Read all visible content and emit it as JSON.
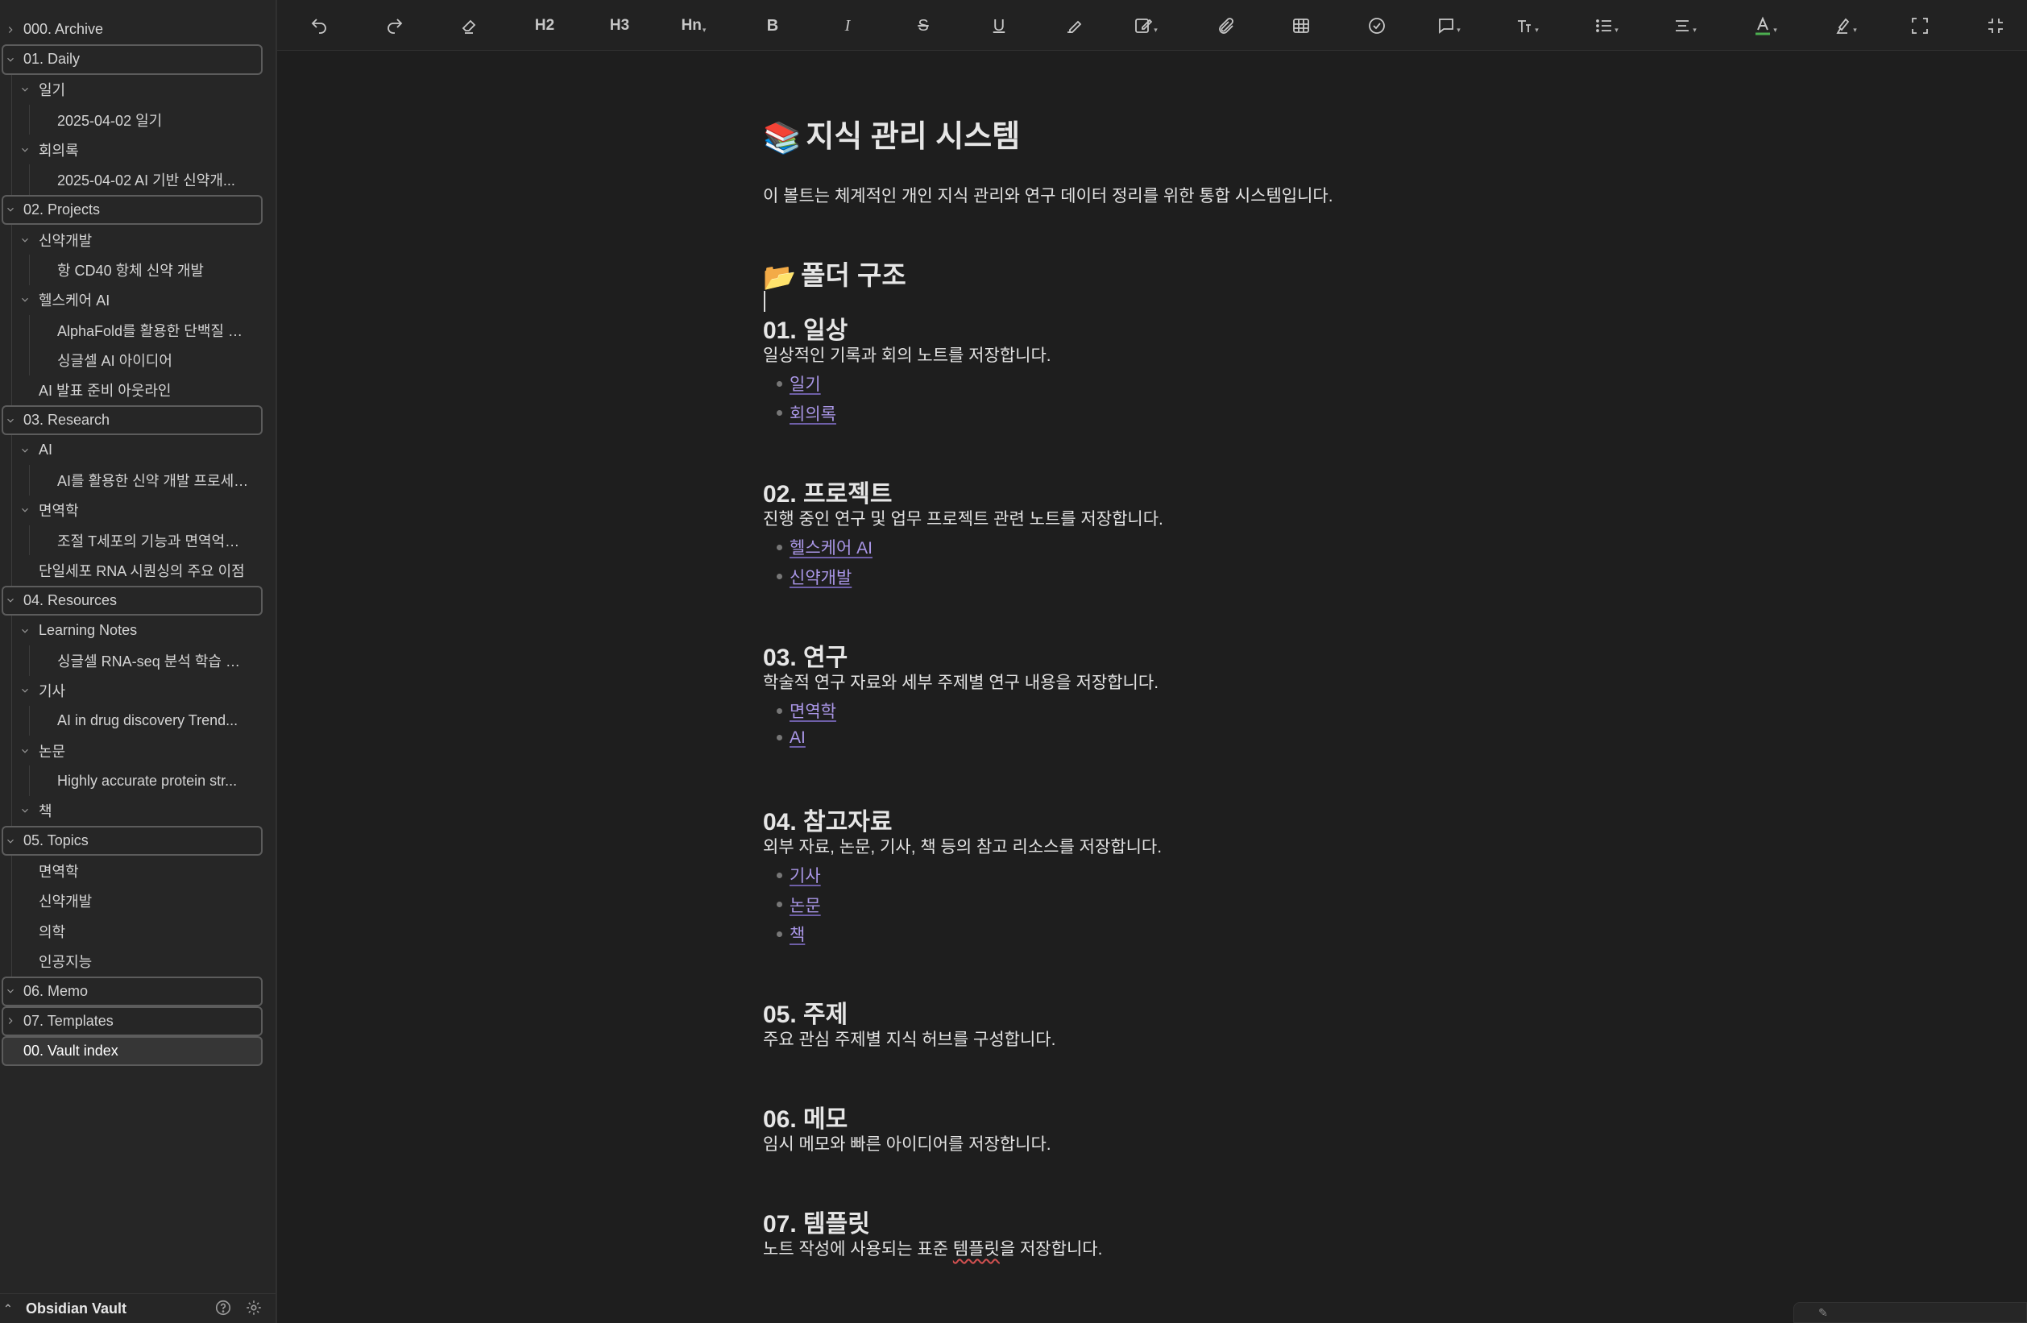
{
  "sidebar": {
    "tree": [
      {
        "label": "000. Archive",
        "depth": 0,
        "state": "collapsed",
        "style": "plain"
      },
      {
        "label": "01. Daily",
        "depth": 0,
        "state": "expanded",
        "style": "boxed"
      },
      {
        "label": "일기",
        "depth": 1,
        "state": "expanded"
      },
      {
        "label": "2025-04-02 일기",
        "depth": 2,
        "state": "leaf"
      },
      {
        "label": "회의록",
        "depth": 1,
        "state": "expanded"
      },
      {
        "label": "2025-04-02 AI 기반 신약개...",
        "depth": 2,
        "state": "leaf"
      },
      {
        "label": "02. Projects",
        "depth": 0,
        "state": "expanded",
        "style": "boxed"
      },
      {
        "label": "신약개발",
        "depth": 1,
        "state": "expanded"
      },
      {
        "label": "항 CD40 항체 신약 개발",
        "depth": 2,
        "state": "leaf"
      },
      {
        "label": "헬스케어 AI",
        "depth": 1,
        "state": "expanded"
      },
      {
        "label": "AlphaFold를 활용한 단백질 구...",
        "depth": 2,
        "state": "leaf"
      },
      {
        "label": "싱글셀 AI 아이디어",
        "depth": 2,
        "state": "leaf"
      },
      {
        "label": "AI 발표 준비 아웃라인",
        "depth": 1,
        "state": "leaf"
      },
      {
        "label": "03. Research",
        "depth": 0,
        "state": "expanded",
        "style": "boxed"
      },
      {
        "label": "AI",
        "depth": 1,
        "state": "expanded"
      },
      {
        "label": "AI를 활용한 신약 개발 프로세스...",
        "depth": 2,
        "state": "leaf"
      },
      {
        "label": "면역학",
        "depth": 1,
        "state": "expanded"
      },
      {
        "label": "조절 T세포의 기능과 면역억제 ...",
        "depth": 2,
        "state": "leaf"
      },
      {
        "label": "단일세포 RNA 시퀀싱의 주요 이점",
        "depth": 1,
        "state": "leaf"
      },
      {
        "label": "04. Resources",
        "depth": 0,
        "state": "expanded",
        "style": "boxed"
      },
      {
        "label": "Learning Notes",
        "depth": 1,
        "state": "expanded"
      },
      {
        "label": "싱글셀 RNA-seq 분석 학습 계획",
        "depth": 2,
        "state": "leaf"
      },
      {
        "label": "기사",
        "depth": 1,
        "state": "expanded"
      },
      {
        "label": "AI in drug discovery Trend...",
        "depth": 2,
        "state": "leaf"
      },
      {
        "label": "논문",
        "depth": 1,
        "state": "expanded"
      },
      {
        "label": "Highly accurate protein str...",
        "depth": 2,
        "state": "leaf"
      },
      {
        "label": "책",
        "depth": 1,
        "state": "expanded"
      },
      {
        "label": "05. Topics",
        "depth": 0,
        "state": "expanded",
        "style": "boxed"
      },
      {
        "label": "면역학",
        "depth": 1,
        "state": "leaf"
      },
      {
        "label": "신약개발",
        "depth": 1,
        "state": "leaf"
      },
      {
        "label": "의학",
        "depth": 1,
        "state": "leaf"
      },
      {
        "label": "인공지능",
        "depth": 1,
        "state": "leaf"
      },
      {
        "label": "06. Memo",
        "depth": 0,
        "state": "expanded",
        "style": "boxed"
      },
      {
        "label": "07. Templates",
        "depth": 0,
        "state": "collapsed",
        "style": "boxed"
      },
      {
        "label": "00. Vault index",
        "depth": 0,
        "state": "leaf",
        "style": "boxed",
        "active": true
      }
    ],
    "vault_name": "Obsidian Vault",
    "help_icon": "help-circle-icon",
    "settings_icon": "gear-icon"
  },
  "toolbar": {
    "h2": "H2",
    "h3": "H3",
    "hn": "Hn",
    "bold": "B",
    "italic": "I",
    "strike": "S",
    "underline": "U",
    "icons": [
      "undo-icon",
      "redo-icon",
      "eraser-icon",
      "heading-2",
      "heading-3",
      "heading-n",
      "bold-icon",
      "italic-icon",
      "strikethrough-icon",
      "underline-icon",
      "highlighter-icon",
      "edit-icon",
      "paperclip-icon",
      "table-icon",
      "check-circle-icon",
      "comment-icon",
      "text-size-icon",
      "list-icon",
      "align-icon",
      "font-color-icon",
      "highlight-color-icon",
      "fullscreen-icon",
      "collapse-icon"
    ]
  },
  "note": {
    "title_emoji": "📚",
    "title": "지식 관리 시스템",
    "intro": "이 볼트는 체계적인 개인 지식 관리와 연구 데이터 정리를 위한 통합 시스템입니다.",
    "folder_emoji": "📂",
    "folder_heading": "폴더 구조",
    "sections": [
      {
        "heading": "01. 일상",
        "desc": "일상적인 기록과 회의 노트를 저장합니다.",
        "links": [
          "일기",
          "회의록"
        ]
      },
      {
        "heading": "02. 프로젝트",
        "desc": "진행 중인 연구 및 업무 프로젝트 관련 노트를 저장합니다.",
        "links": [
          "헬스케어 AI",
          "신약개발"
        ]
      },
      {
        "heading": "03. 연구",
        "desc": "학술적 연구 자료와 세부 주제별 연구 내용을 저장합니다.",
        "links": [
          "면역학",
          "AI"
        ]
      },
      {
        "heading": "04. 참고자료",
        "desc": "외부 자료, 논문, 기사, 책 등의 참고 리소스를 저장합니다.",
        "links": [
          "기사",
          "논문",
          "책"
        ]
      },
      {
        "heading": "05. 주제",
        "desc": "주요 관심 주제별 지식 허브를 구성합니다.",
        "links": []
      },
      {
        "heading": "06. 메모",
        "desc": "임시 메모와 빠른 아이디어를 저장합니다.",
        "links": []
      },
      {
        "heading": "07. 템플릿",
        "desc_prefix": "노트 작성에 사용되는 표준 ",
        "desc_flagged": "템플릿",
        "desc_suffix": "을 저장합니다.",
        "links": []
      }
    ],
    "accent_link_color": "#a996e6"
  }
}
